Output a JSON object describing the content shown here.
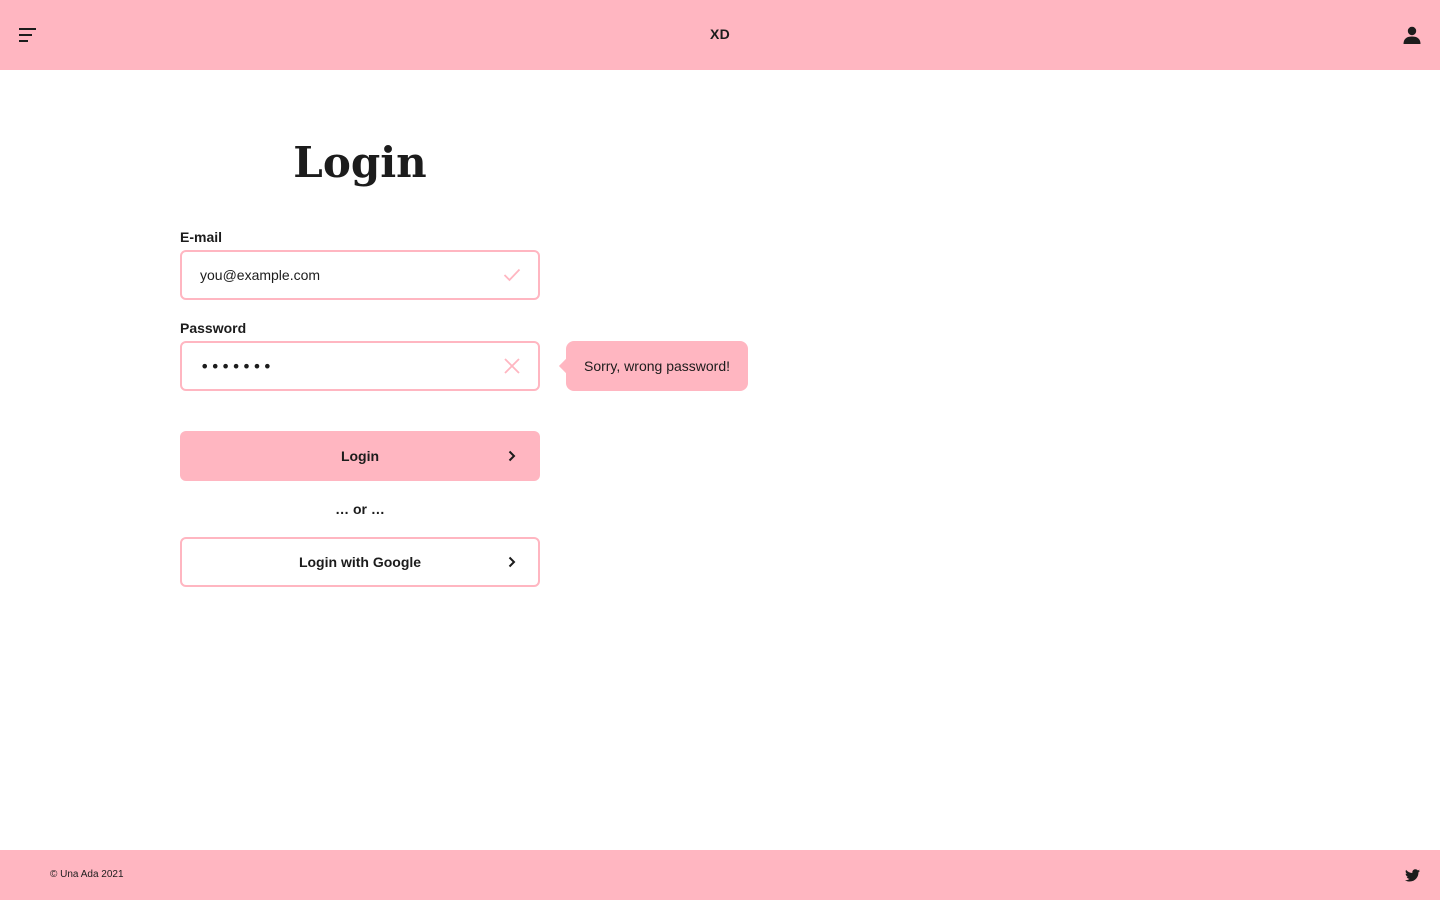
{
  "header": {
    "brand": "XD",
    "menu_icon": "hamburger-menu-icon",
    "account_icon": "user-icon"
  },
  "login_form": {
    "title": "Login",
    "email": {
      "label": "E-mail",
      "value": "you@example.com",
      "status_icon": "check-icon"
    },
    "password": {
      "label": "Password",
      "value": "•••••••",
      "status_icon": "close-icon",
      "error_message": "Sorry, wrong password!"
    },
    "login_button": {
      "label": "Login",
      "icon": "chevron-right-icon"
    },
    "divider_text": "… or …",
    "google_button": {
      "label": "Login with Google",
      "icon": "chevron-right-icon"
    }
  },
  "footer": {
    "copyright": "© Una Ada 2021",
    "social_icon": "twitter-icon"
  },
  "colors": {
    "accent": "#ffb6c1",
    "text": "#1c1c1c",
    "background": "#ffffff"
  }
}
